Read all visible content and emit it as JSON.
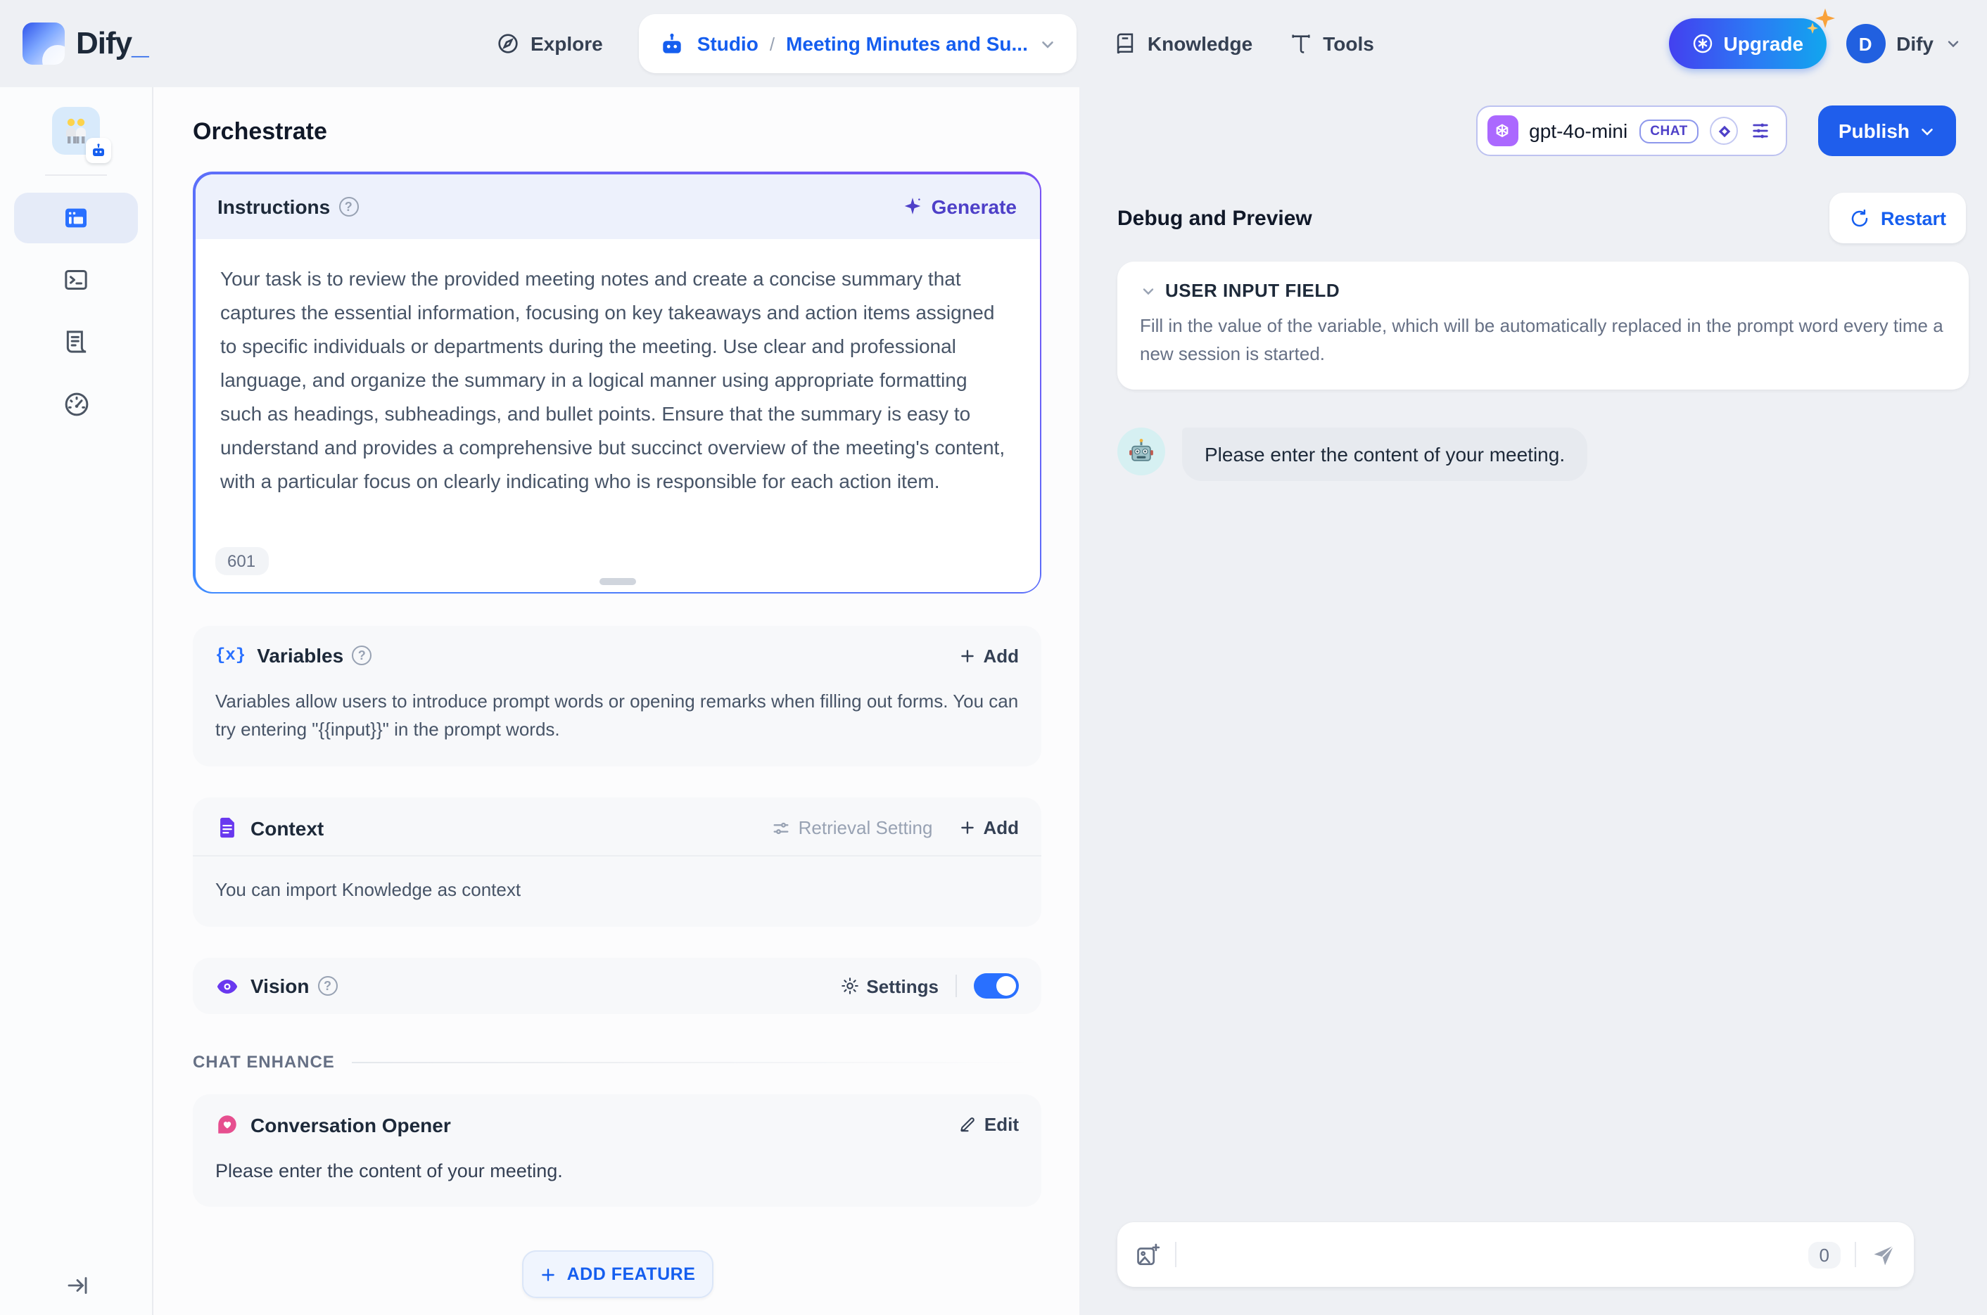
{
  "header": {
    "logo_text": "Dify",
    "nav": {
      "explore": "Explore",
      "knowledge": "Knowledge",
      "tools": "Tools"
    },
    "breadcrumb": {
      "section": "Studio",
      "separator": "/",
      "app_name": "Meeting Minutes and Su..."
    },
    "upgrade_label": "Upgrade",
    "account": {
      "avatar_initial": "D",
      "name": "Dify"
    }
  },
  "page": {
    "title": "Orchestrate",
    "model_bar": {
      "model_name": "gpt-4o-mini",
      "mode_badge": "CHAT",
      "publish_label": "Publish"
    }
  },
  "instructions": {
    "title": "Instructions",
    "generate_label": "Generate",
    "body": "Your task is to review the provided meeting notes and create a concise summary that captures the essential information, focusing on key takeaways and action items assigned to specific individuals or departments during the meeting. Use clear and professional language, and organize the summary in a logical manner using appropriate formatting such as headings, subheadings, and bullet points. Ensure that the summary is easy to understand and provides a comprehensive but succinct overview of the meeting's content, with a particular focus on clearly indicating who is responsible for each action item.",
    "char_count": "601"
  },
  "variables": {
    "title": "Variables",
    "add_label": "Add",
    "description": "Variables allow users to introduce prompt words or opening remarks when filling out forms. You can try entering \"{{input}}\" in the prompt words."
  },
  "context": {
    "title": "Context",
    "retrieval_setting_label": "Retrieval Setting",
    "add_label": "Add",
    "description": "You can import Knowledge as context"
  },
  "vision": {
    "title": "Vision",
    "settings_label": "Settings",
    "enabled": true
  },
  "chat_enhance": {
    "label": "CHAT ENHANCE"
  },
  "conversation_opener": {
    "title": "Conversation Opener",
    "edit_label": "Edit",
    "message": "Please enter the content of your meeting."
  },
  "add_feature_label": "ADD FEATURE",
  "debug": {
    "title": "Debug and Preview",
    "restart_label": "Restart",
    "user_input_field": {
      "title": "USER INPUT FIELD",
      "description": "Fill in the value of the variable, which will be automatically replaced in the prompt word every time a new session is started."
    },
    "bot_message": "Please enter the content of your meeting.",
    "input": {
      "placeholder": "",
      "char_count": "0"
    }
  },
  "colors": {
    "primary_blue": "#155eef",
    "indigo_accent": "#4e40c8",
    "purple_icon": "#6938ef",
    "toggle_on": "#2970ff",
    "openai_chip": "#ab68ff"
  }
}
